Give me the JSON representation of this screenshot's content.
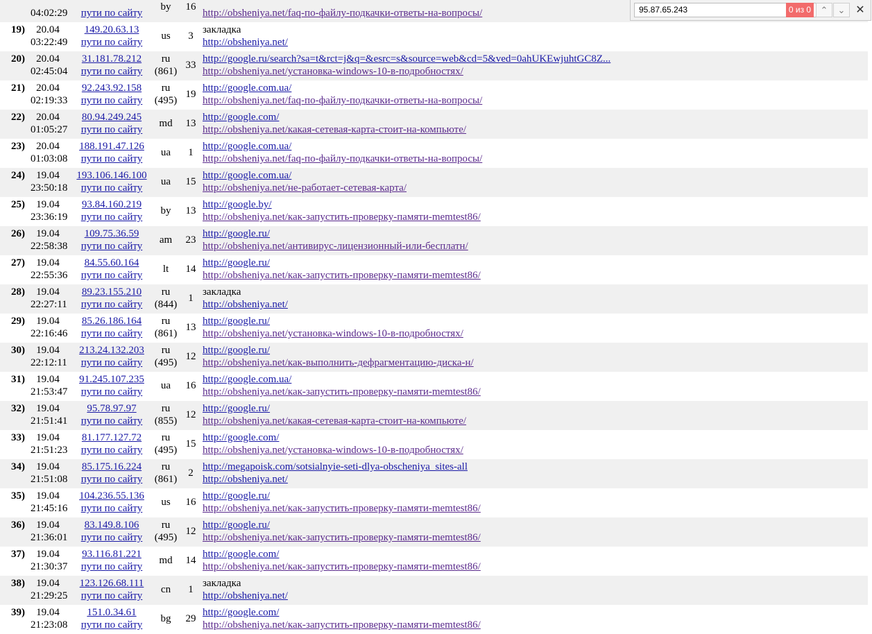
{
  "find_bar": {
    "query": "95.87.65.243",
    "match_count": "0 из 0",
    "prev_icon": "chevron-up-icon",
    "next_icon": "chevron-down-icon",
    "close_icon": "close-icon"
  },
  "rows": [
    {
      "num": "",
      "date": "",
      "time": "04:02:29",
      "ip": "",
      "path": "пути по сайту",
      "country": "by",
      "code": "",
      "count": "16",
      "referrer": "",
      "referrer_is_link": false,
      "page": "http://obsheniya.net/faq-по-файлу-подкачки-ответы-на-вопросы/"
    },
    {
      "num": "19)",
      "date": "20.04",
      "time": "03:22:49",
      "ip": "149.20.63.13",
      "path": "пути по сайту",
      "country": "us",
      "code": "",
      "count": "3",
      "referrer": "закладка",
      "referrer_is_link": false,
      "page": "http://obsheniya.net/"
    },
    {
      "num": "20)",
      "date": "20.04",
      "time": "02:45:04",
      "ip": "31.181.78.212",
      "path": "пути по сайту",
      "country": "ru",
      "code": "(861)",
      "count": "33",
      "referrer": "http://google.ru/search?sa=t&rct=j&q=&esrc=s&source=web&cd=5&ved=0ahUKEwjuhtGC8Z...",
      "referrer_is_link": true,
      "page": "http://obsheniya.net/установка-windows-10-в-подробностях/"
    },
    {
      "num": "21)",
      "date": "20.04",
      "time": "02:19:33",
      "ip": "92.243.92.158",
      "path": "пути по сайту",
      "country": "ru",
      "code": "(495)",
      "count": "19",
      "referrer": "http://google.com.ua/",
      "referrer_is_link": true,
      "page": "http://obsheniya.net/faq-по-файлу-подкачки-ответы-на-вопросы/"
    },
    {
      "num": "22)",
      "date": "20.04",
      "time": "01:05:27",
      "ip": "80.94.249.245",
      "path": "пути по сайту",
      "country": "md",
      "code": "",
      "count": "13",
      "referrer": "http://google.com/",
      "referrer_is_link": true,
      "page": "http://obsheniya.net/какая-сетевая-карта-стоит-на-компьюте/"
    },
    {
      "num": "23)",
      "date": "20.04",
      "time": "01:03:08",
      "ip": "188.191.47.126",
      "path": "пути по сайту",
      "country": "ua",
      "code": "",
      "count": "1",
      "referrer": "http://google.com.ua/",
      "referrer_is_link": true,
      "page": "http://obsheniya.net/faq-по-файлу-подкачки-ответы-на-вопросы/"
    },
    {
      "num": "24)",
      "date": "19.04",
      "time": "23:50:18",
      "ip": "193.106.146.100",
      "path": "пути по сайту",
      "country": "ua",
      "code": "",
      "count": "15",
      "referrer": "http://google.com.ua/",
      "referrer_is_link": true,
      "page": "http://obsheniya.net/не-работает-сетевая-карта/"
    },
    {
      "num": "25)",
      "date": "19.04",
      "time": "23:36:19",
      "ip": "93.84.160.219",
      "path": "пути по сайту",
      "country": "by",
      "code": "",
      "count": "13",
      "referrer": "http://google.by/",
      "referrer_is_link": true,
      "page": "http://obsheniya.net/как-запустить-проверку-памяти-memtest86/"
    },
    {
      "num": "26)",
      "date": "19.04",
      "time": "22:58:38",
      "ip": "109.75.36.59",
      "path": "пути по сайту",
      "country": "am",
      "code": "",
      "count": "23",
      "referrer": "http://google.ru/",
      "referrer_is_link": true,
      "page": "http://obsheniya.net/антивирус-лицензионный-или-бесплатн/"
    },
    {
      "num": "27)",
      "date": "19.04",
      "time": "22:55:36",
      "ip": "84.55.60.164",
      "path": "пути по сайту",
      "country": "lt",
      "code": "",
      "count": "14",
      "referrer": "http://google.ru/",
      "referrer_is_link": true,
      "page": "http://obsheniya.net/как-запустить-проверку-памяти-memtest86/"
    },
    {
      "num": "28)",
      "date": "19.04",
      "time": "22:27:11",
      "ip": "89.23.155.210",
      "path": "пути по сайту",
      "country": "ru",
      "code": "(844)",
      "count": "1",
      "referrer": "закладка",
      "referrer_is_link": false,
      "page": "http://obsheniya.net/"
    },
    {
      "num": "29)",
      "date": "19.04",
      "time": "22:16:46",
      "ip": "85.26.186.164",
      "path": "пути по сайту",
      "country": "ru",
      "code": "(861)",
      "count": "13",
      "referrer": "http://google.ru/",
      "referrer_is_link": true,
      "page": "http://obsheniya.net/установка-windows-10-в-подробностях/"
    },
    {
      "num": "30)",
      "date": "19.04",
      "time": "22:12:11",
      "ip": "213.24.132.203",
      "path": "пути по сайту",
      "country": "ru",
      "code": "(495)",
      "count": "12",
      "referrer": "http://google.ru/",
      "referrer_is_link": true,
      "page": "http://obsheniya.net/как-выполнить-дефрагментацию-диска-н/"
    },
    {
      "num": "31)",
      "date": "19.04",
      "time": "21:53:47",
      "ip": "91.245.107.235",
      "path": "пути по сайту",
      "country": "ua",
      "code": "",
      "count": "16",
      "referrer": "http://google.com.ua/",
      "referrer_is_link": true,
      "page": "http://obsheniya.net/как-запустить-проверку-памяти-memtest86/"
    },
    {
      "num": "32)",
      "date": "19.04",
      "time": "21:51:41",
      "ip": "95.78.97.97",
      "path": "пути по сайту",
      "country": "ru",
      "code": "(855)",
      "count": "12",
      "referrer": "http://google.ru/",
      "referrer_is_link": true,
      "page": "http://obsheniya.net/какая-сетевая-карта-стоит-на-компьюте/"
    },
    {
      "num": "33)",
      "date": "19.04",
      "time": "21:51:23",
      "ip": "81.177.127.72",
      "path": "пути по сайту",
      "country": "ru",
      "code": "(495)",
      "count": "15",
      "referrer": "http://google.com/",
      "referrer_is_link": true,
      "page": "http://obsheniya.net/установка-windows-10-в-подробностях/"
    },
    {
      "num": "34)",
      "date": "19.04",
      "time": "21:51:08",
      "ip": "85.175.16.224",
      "path": "пути по сайту",
      "country": "ru",
      "code": "(861)",
      "count": "2",
      "referrer": "http://megapoisk.com/sotsialnyie-seti-dlya-obscheniya_sites-all",
      "referrer_is_link": true,
      "page": "http://obsheniya.net/"
    },
    {
      "num": "35)",
      "date": "19.04",
      "time": "21:45:16",
      "ip": "104.236.55.136",
      "path": "пути по сайту",
      "country": "us",
      "code": "",
      "count": "16",
      "referrer": "http://google.ru/",
      "referrer_is_link": true,
      "page": "http://obsheniya.net/как-запустить-проверку-памяти-memtest86/"
    },
    {
      "num": "36)",
      "date": "19.04",
      "time": "21:36:01",
      "ip": "83.149.8.106",
      "path": "пути по сайту",
      "country": "ru",
      "code": "(495)",
      "count": "12",
      "referrer": "http://google.ru/",
      "referrer_is_link": true,
      "page": "http://obsheniya.net/как-запустить-проверку-памяти-memtest86/"
    },
    {
      "num": "37)",
      "date": "19.04",
      "time": "21:30:37",
      "ip": "93.116.81.221",
      "path": "пути по сайту",
      "country": "md",
      "code": "",
      "count": "14",
      "referrer": "http://google.com/",
      "referrer_is_link": true,
      "page": "http://obsheniya.net/как-запустить-проверку-памяти-memtest86/"
    },
    {
      "num": "38)",
      "date": "19.04",
      "time": "21:29:25",
      "ip": "123.126.68.111",
      "path": "пути по сайту",
      "country": "cn",
      "code": "",
      "count": "1",
      "referrer": "закладка",
      "referrer_is_link": false,
      "page": "http://obsheniya.net/"
    },
    {
      "num": "39)",
      "date": "19.04",
      "time": "21:23:08",
      "ip": "151.0.34.61",
      "path": "пути по сайту",
      "country": "bg",
      "code": "",
      "count": "29",
      "referrer": "http://google.com/",
      "referrer_is_link": true,
      "page": "http://obsheniya.net/как-запустить-проверку-памяти-memtest86/"
    }
  ]
}
